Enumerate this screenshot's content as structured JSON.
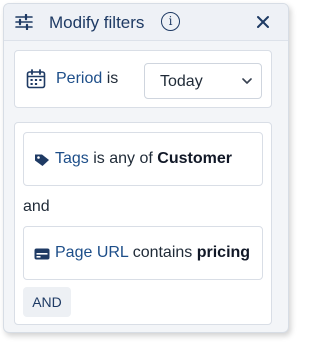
{
  "header": {
    "title": "Modify filters",
    "info_glyph": "i"
  },
  "period": {
    "label": "Period",
    "verb": "is",
    "selected": "Today"
  },
  "conditions": [
    {
      "icon": "tag-icon",
      "field": "Tags",
      "operator": "is any of",
      "value": "Customer"
    },
    {
      "icon": "page-url-icon",
      "field": "Page URL",
      "operator": "contains",
      "value": "pricing"
    }
  ],
  "connector": "and",
  "add_and_label": "AND",
  "colors": {
    "accent": "#1d4e89",
    "title": "#1e3a64"
  }
}
